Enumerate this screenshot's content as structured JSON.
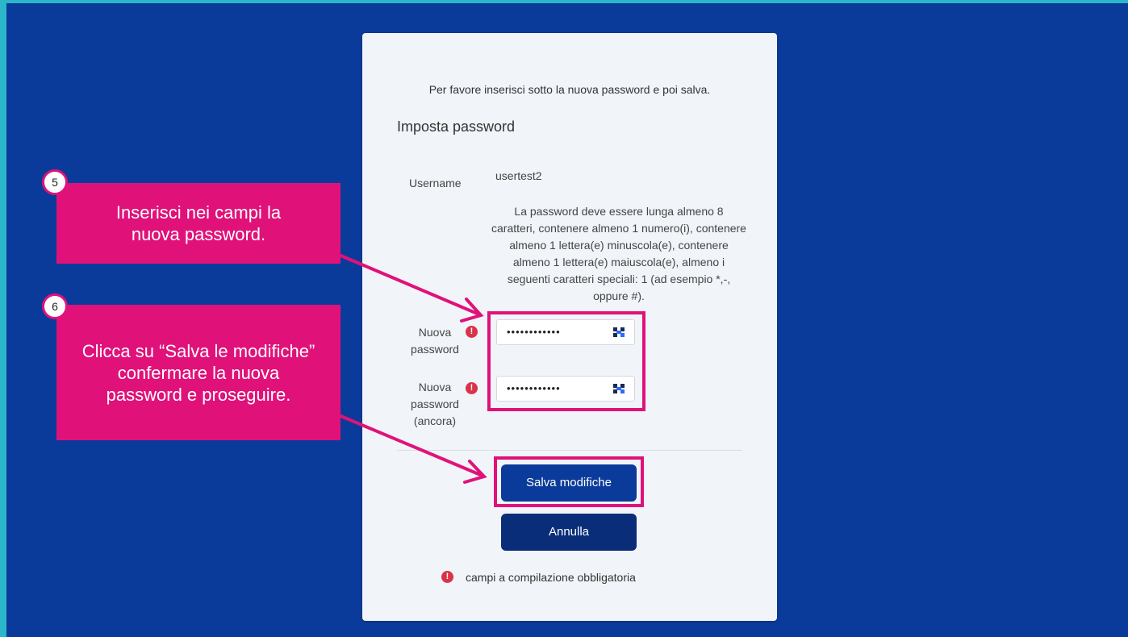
{
  "intro_text": "Per favore inserisci sotto la nuova password e poi salva.",
  "section_title": "Imposta password",
  "username_label": "Username",
  "username_value": "usertest2",
  "password_rules": "La password deve essere lunga almeno 8 caratteri, contenere almeno 1 numero(i), contenere almeno 1 lettera(e) minuscola(e), contenere almeno 1 lettera(e) maiuscola(e), almeno i seguenti caratteri speciali: 1 (ad esempio *,-, oppure #).",
  "new_password_label": "Nuova password",
  "new_password_value": "••••••••••••",
  "new_password_again_label": "Nuova password (ancora)",
  "new_password_again_value": "••••••••••••",
  "required_mark": "!",
  "save_button": "Salva modifiche",
  "cancel_button": "Annulla",
  "required_note": "campi a compilazione obbligatoria",
  "callouts": [
    {
      "step": "5",
      "text": "Inserisci nei campi la nuova password."
    },
    {
      "step": "6",
      "text": "Clicca su “Salva le modifiche” confermare la nuova password e proseguire."
    }
  ],
  "colors": {
    "background": "#0b3b9a",
    "frame_border": "#2bb7c9",
    "highlight": "#e0127a",
    "button_primary": "#0b3b9a",
    "button_secondary": "#0a2d7a",
    "required": "#d9334a"
  }
}
